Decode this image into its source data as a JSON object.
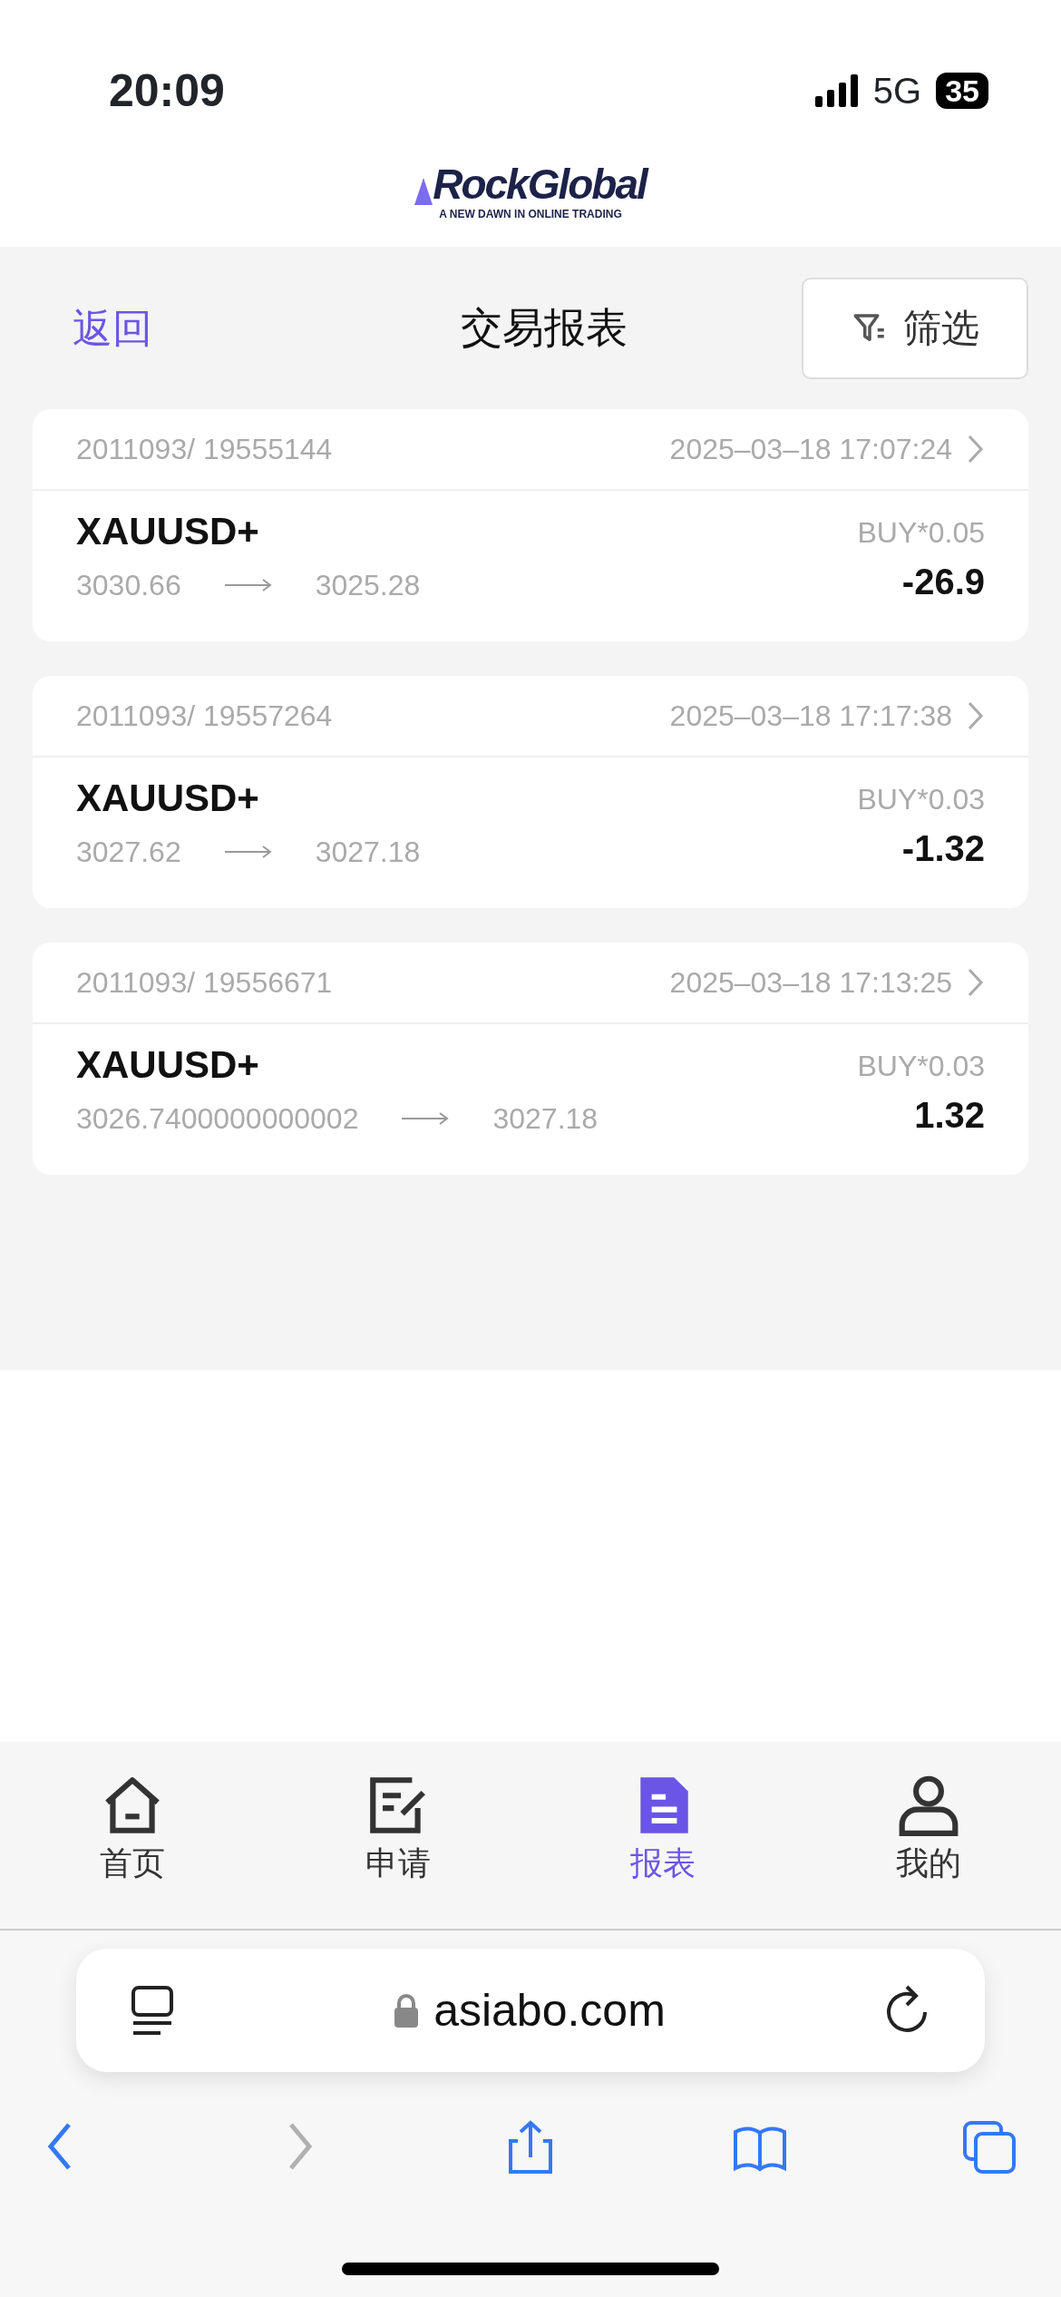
{
  "status_bar": {
    "time": "20:09",
    "network": "5G",
    "battery": "35"
  },
  "logo": {
    "name": "RockGlobal",
    "tagline": "A NEW DAWN IN ONLINE TRADING"
  },
  "header": {
    "back": "返回",
    "title": "交易报表",
    "filter": "筛选"
  },
  "trades": [
    {
      "account": "2011093/ 19555144",
      "time": "2025–03–18 17:07:24",
      "symbol": "XAUUSD+",
      "open": "3030.66",
      "close": "3025.28",
      "order": "BUY*0.05",
      "profit": "-26.9"
    },
    {
      "account": "2011093/ 19557264",
      "time": "2025–03–18 17:17:38",
      "symbol": "XAUUSD+",
      "open": "3027.62",
      "close": "3027.18",
      "order": "BUY*0.03",
      "profit": "-1.32"
    },
    {
      "account": "2011093/ 19556671",
      "time": "2025–03–18 17:13:25",
      "symbol": "XAUUSD+",
      "open": "3026.7400000000002",
      "close": "3027.18",
      "order": "BUY*0.03",
      "profit": "1.32"
    }
  ],
  "tab_bar": [
    {
      "kind": "home",
      "label": "首页",
      "selected": false
    },
    {
      "kind": "edit",
      "label": "申请",
      "selected": false
    },
    {
      "kind": "report",
      "label": "报表",
      "selected": true
    },
    {
      "kind": "profile",
      "label": "我的",
      "selected": false
    }
  ],
  "browser": {
    "url": "asiabo.com",
    "toolbar": [
      {
        "kind": "back",
        "disabled": false
      },
      {
        "kind": "forward",
        "disabled": true
      },
      {
        "kind": "share",
        "disabled": false
      },
      {
        "kind": "bookmarks",
        "disabled": false
      },
      {
        "kind": "tabs",
        "disabled": false
      }
    ]
  }
}
